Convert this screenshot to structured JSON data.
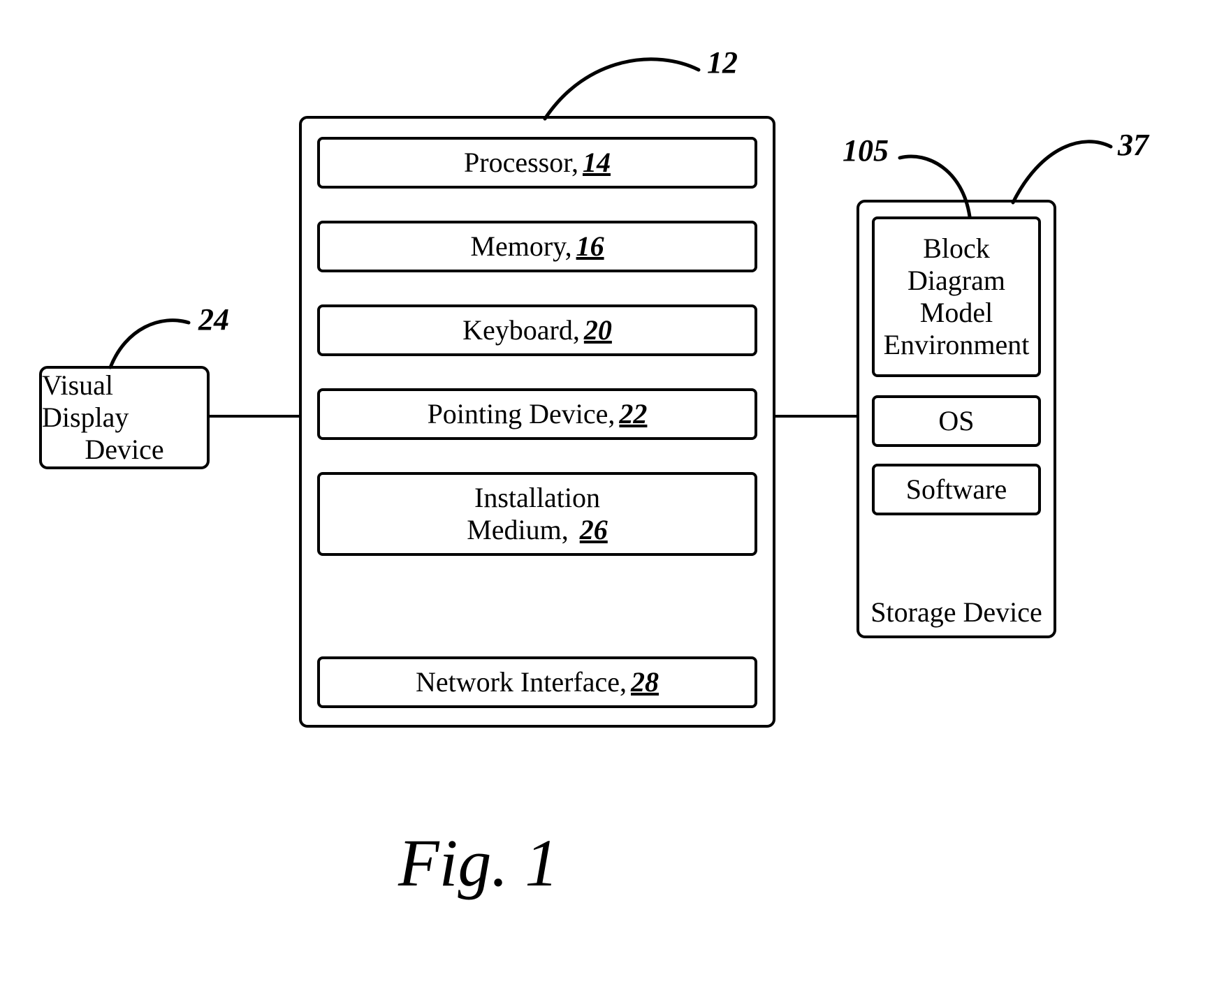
{
  "refs": {
    "main": "12",
    "processor": "14",
    "memory": "16",
    "keyboard": "20",
    "pointing": "22",
    "display": "24",
    "install": "26",
    "net": "28",
    "storage": "37",
    "bdme": "105"
  },
  "labels": {
    "processor": "Processor,",
    "memory": "Memory,",
    "keyboard": "Keyboard,",
    "pointing": "Pointing Device,",
    "install_l1": "Installation",
    "install_l2": "Medium,",
    "net": "Network Interface,",
    "display_l1": "Visual Display",
    "display_l2": "Device",
    "bdme_l1": "Block",
    "bdme_l2": "Diagram",
    "bdme_l3": "Model",
    "bdme_l4": "Environment",
    "os": "OS",
    "software": "Software",
    "storage": "Storage Device"
  },
  "caption": "Fig. 1"
}
